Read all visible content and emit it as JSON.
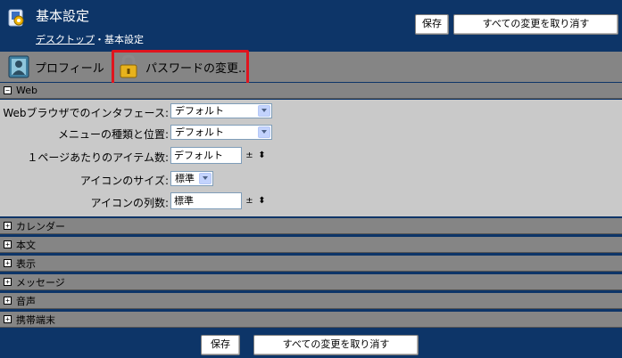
{
  "header": {
    "title": "基本設定",
    "breadcrumb_link": "デスクトップ",
    "breadcrumb_sep": "・",
    "breadcrumb_current": "基本設定",
    "save_label": "保存",
    "cancel_label": "すべての変更を取り消す"
  },
  "toolbar": {
    "profile_label": "プロフィール",
    "password_label": "パスワードの変更..."
  },
  "web": {
    "title": "Web",
    "rows": {
      "interface": {
        "label": "Webブラウザでのインタフェース:",
        "value": "デフォルト"
      },
      "menu": {
        "label": "メニューの種類と位置:",
        "value": "デフォルト"
      },
      "items_per_page": {
        "label": "１ページあたりのアイテム数:",
        "value": "デフォルト"
      },
      "icon_size": {
        "label": "アイコンのサイズ:",
        "value": "標準"
      },
      "icon_columns": {
        "label": "アイコンの列数:",
        "value": "標準"
      }
    }
  },
  "sections": [
    "カレンダー",
    "本文",
    "表示",
    "メッセージ",
    "音声",
    "携帯端末"
  ],
  "footer": {
    "save_label": "保存",
    "cancel_label": "すべての変更を取り消す"
  },
  "colors": {
    "brand": "#0d3568",
    "section_bg": "#858585",
    "panel_bg": "#c9c9c9",
    "highlight": "#e0141e"
  }
}
